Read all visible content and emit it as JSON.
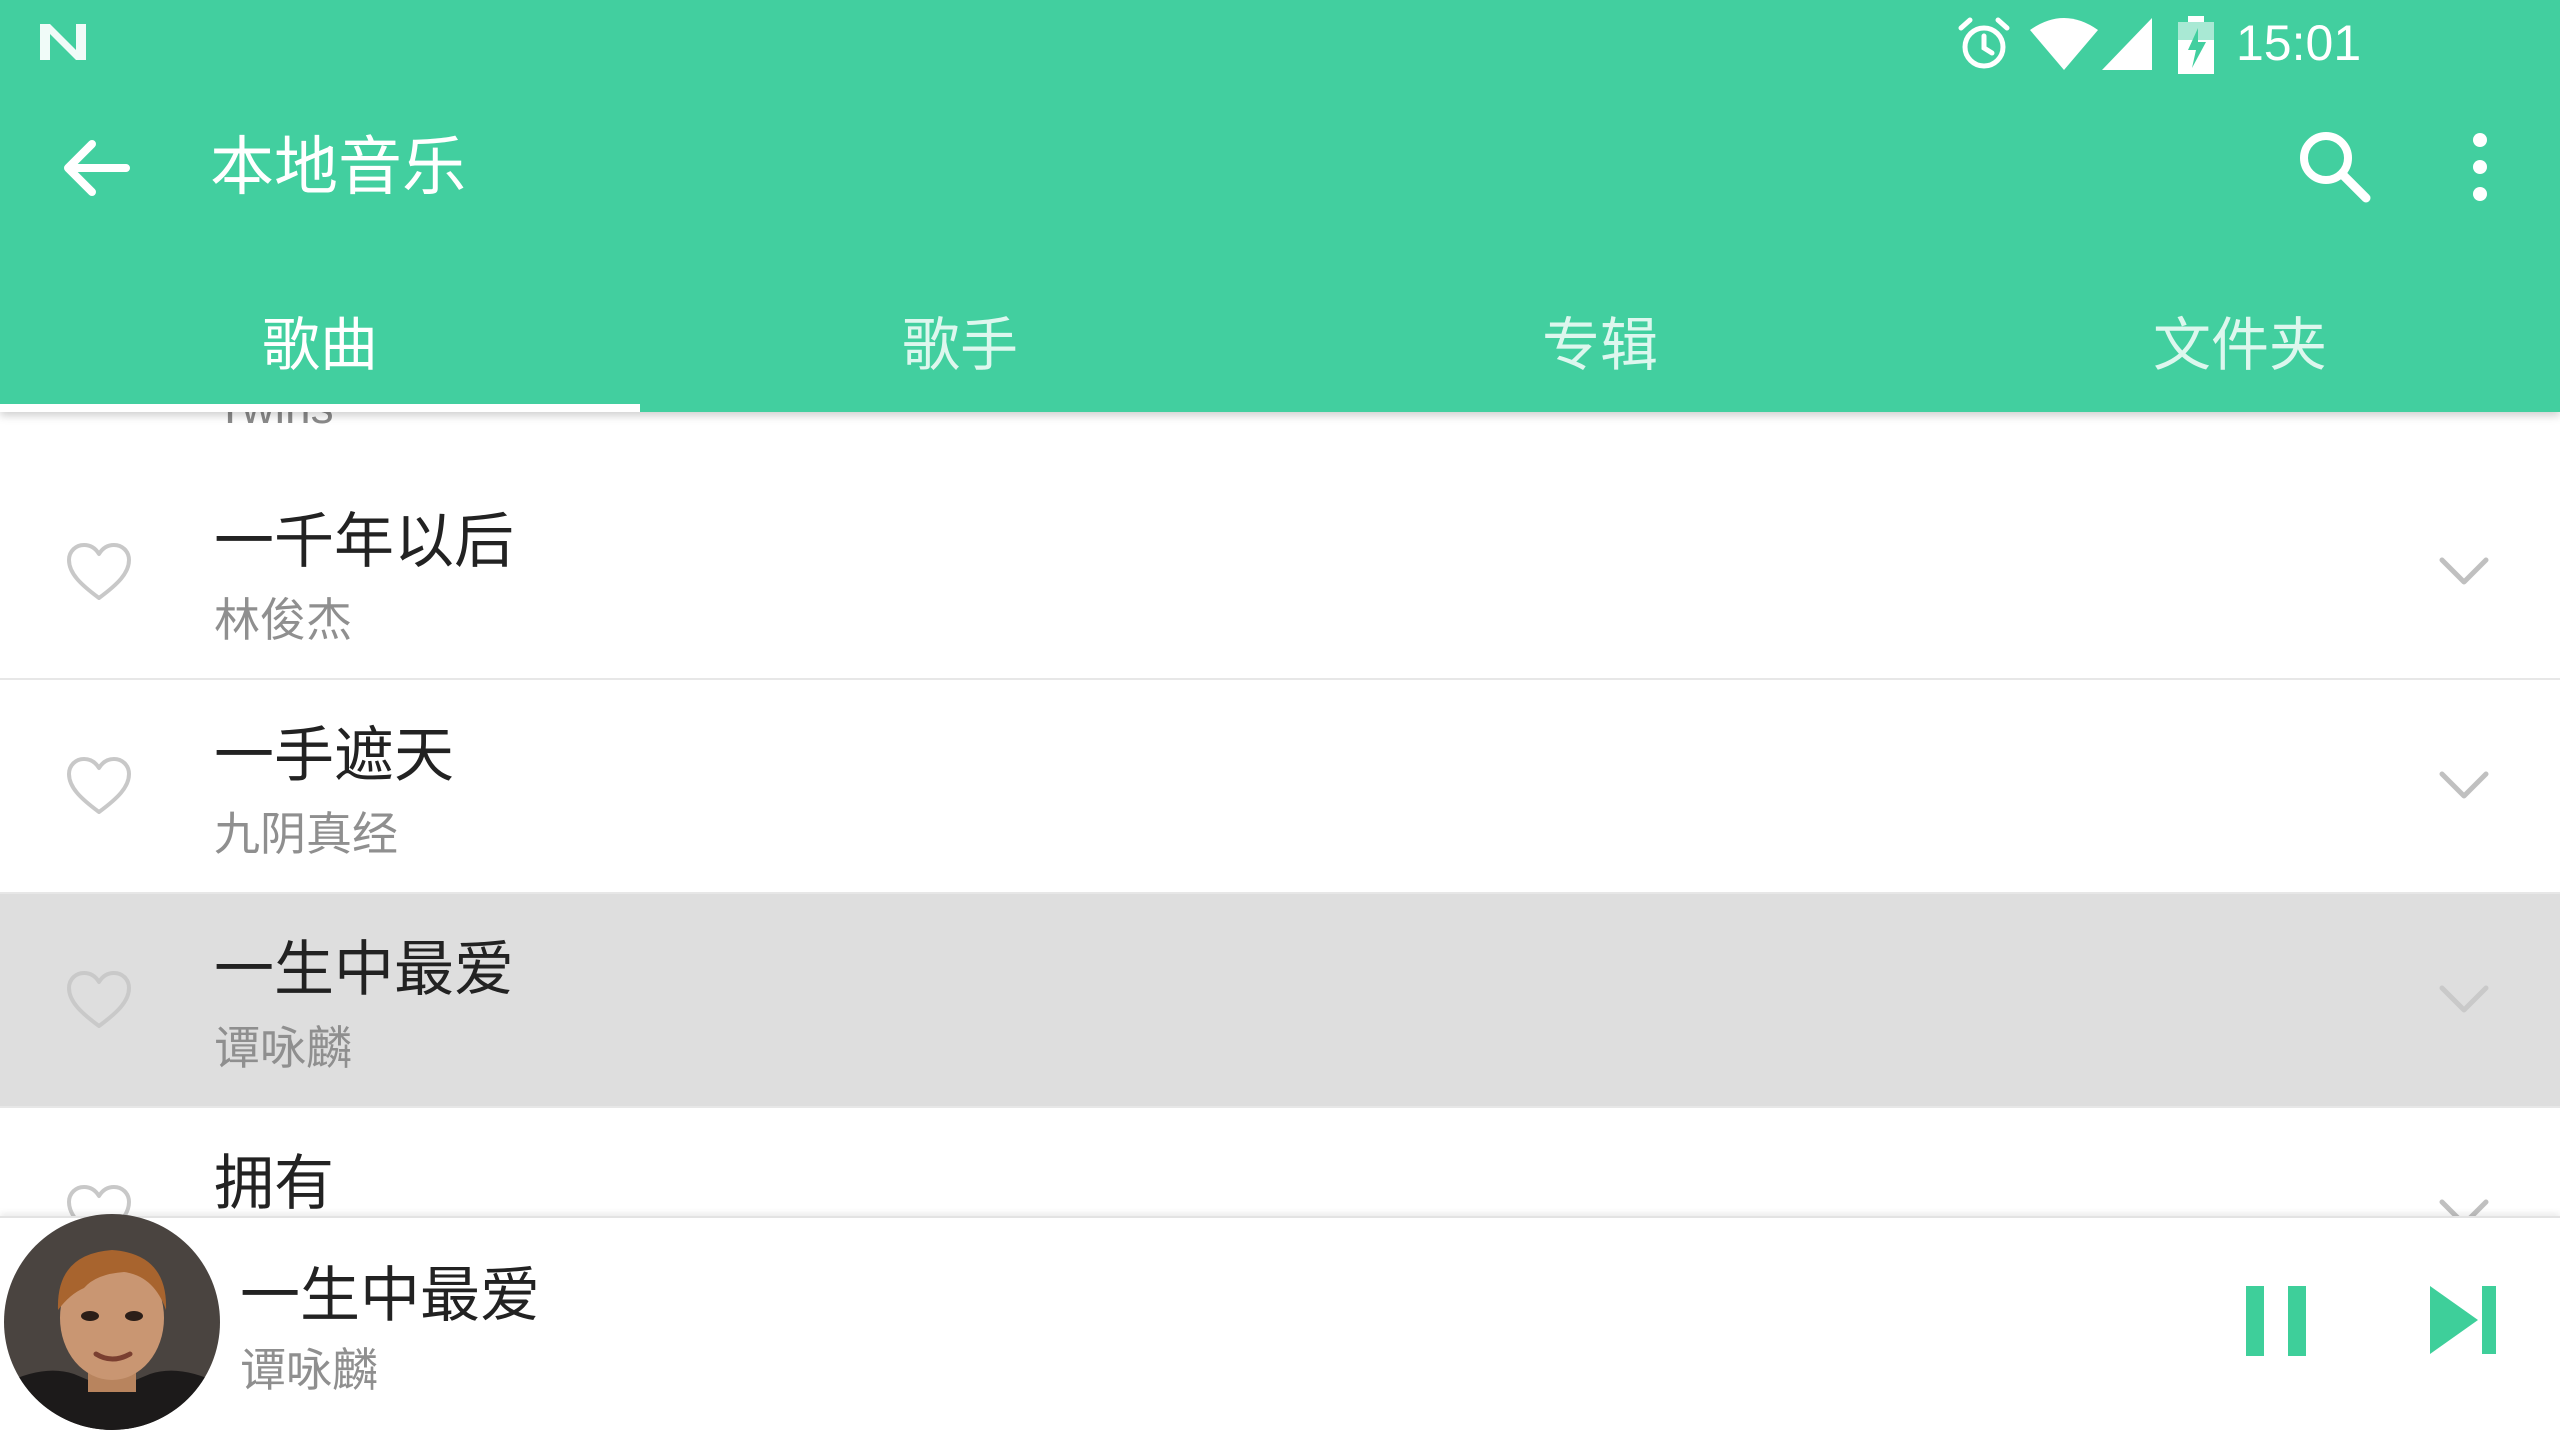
{
  "colors": {
    "primary": "#42CF9F",
    "accent_icon": "#3ECF9A",
    "selected_row": "#DEDEDE",
    "divider": "#E7E7E7"
  },
  "status_bar": {
    "logo_icon": "n-logo-icon",
    "alarm_icon": "alarm-icon",
    "wifi_icon": "wifi-icon",
    "signal_icon": "cell-signal-icon",
    "battery_icon": "battery-charging-icon",
    "time": "15:01"
  },
  "toolbar": {
    "back_icon": "arrow-back-icon",
    "title": "本地音乐",
    "search_icon": "search-icon",
    "more_icon": "more-vert-icon"
  },
  "tabs": [
    {
      "label": "歌曲",
      "active": true
    },
    {
      "label": "歌手",
      "active": false
    },
    {
      "label": "专辑",
      "active": false
    },
    {
      "label": "文件夹",
      "active": false
    }
  ],
  "list": {
    "partial_artist": "Twins",
    "songs": [
      {
        "title": "一千年以后",
        "artist": "林俊杰",
        "selected": false
      },
      {
        "title": "一手遮天",
        "artist": "九阴真经",
        "selected": false
      },
      {
        "title": "一生中最爱",
        "artist": "谭咏麟",
        "selected": true
      },
      {
        "title": "拥有",
        "artist": "",
        "selected": false
      }
    ]
  },
  "now_playing": {
    "title": "一生中最爱",
    "artist": "谭咏麟",
    "pause_icon": "pause-icon",
    "next_icon": "skip-next-icon",
    "cover_icon": "album-cover-avatar"
  }
}
